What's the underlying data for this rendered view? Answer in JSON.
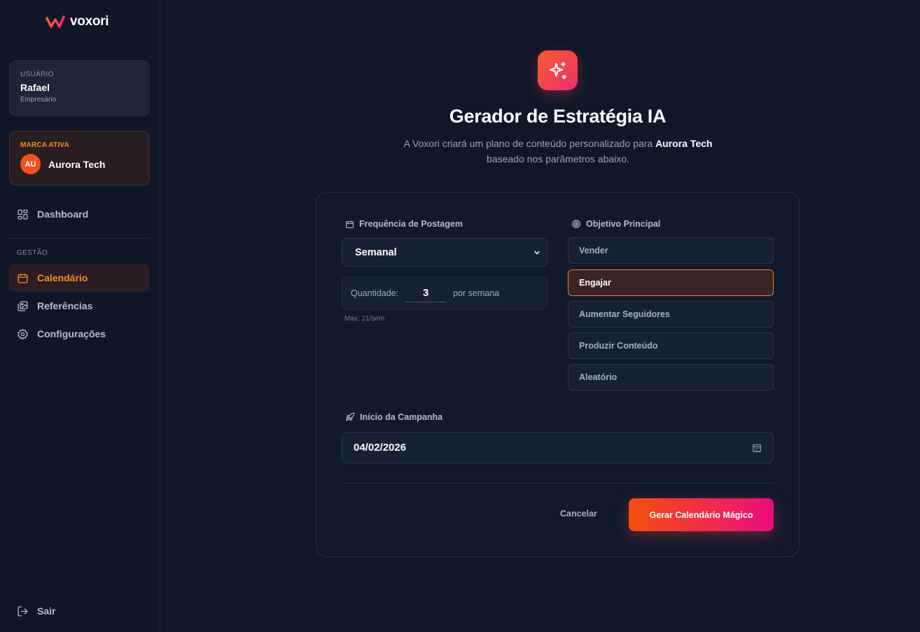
{
  "app": {
    "name": "voxori"
  },
  "user": {
    "label": "USUÁRIO",
    "name": "Rafael",
    "role": "Empresário"
  },
  "brand": {
    "label": "MARCA ATIVA",
    "initials": "AU",
    "name": "Aurora Tech"
  },
  "nav": {
    "dashboard": "Dashboard",
    "section": "GESTÃO",
    "calendar": "Calendário",
    "references": "Referências",
    "settings": "Configurações",
    "logout": "Sair"
  },
  "header": {
    "title": "Gerador de Estratégia IA",
    "subtitle_pre": "A Voxori criará um plano de conteúdo personalizado para ",
    "subtitle_brand": "Aurora Tech",
    "subtitle_post": " baseado nos parâmetros abaixo."
  },
  "form": {
    "frequency_label": "Frequência de Postagem",
    "frequency_value": "Semanal",
    "quantity_label": "Quantidade:",
    "quantity_value": "3",
    "quantity_unit": "por semana",
    "quantity_max": "Max: 21/sem",
    "objective_label": "Objetivo Principal",
    "objectives": [
      "Vender",
      "Engajar",
      "Aumentar Seguidores",
      "Produzir Conteúdo",
      "Aleatório"
    ],
    "selected_objective": "Engajar",
    "start_label": "Início da Campanha",
    "start_value": "04/02/2026",
    "cancel": "Cancelar",
    "submit": "Gerar Calendário Mágico"
  },
  "colors": {
    "accent": "#fb8c1a",
    "gradient_start": "#f54f0d",
    "gradient_end": "#ec0d7c",
    "background": "#0f1729"
  }
}
